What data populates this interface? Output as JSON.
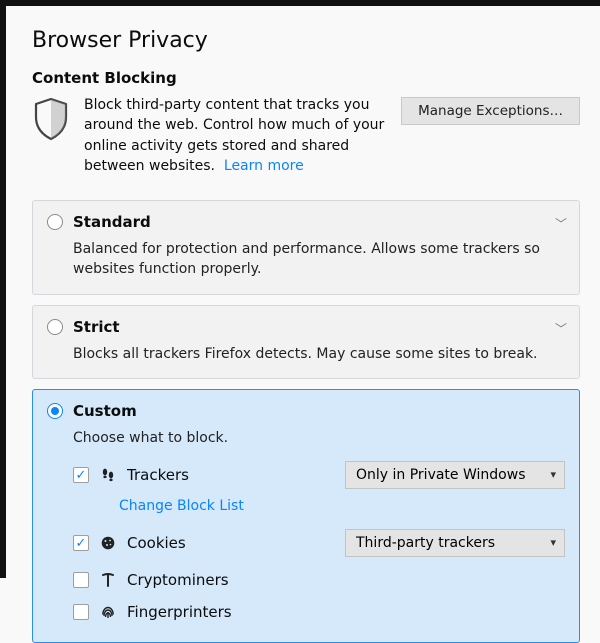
{
  "pageTitle": "Browser Privacy",
  "section": {
    "title": "Content Blocking",
    "desc": "Block third-party content that tracks you around the web. Control how much of your online activity gets stored and shared between websites.",
    "learnMore": "Learn more",
    "manageBtn": "Manage Exceptions…"
  },
  "options": {
    "standard": {
      "title": "Standard",
      "desc": "Balanced for protection and performance. Allows some trackers so websites function properly."
    },
    "strict": {
      "title": "Strict",
      "desc": "Blocks all trackers Firefox detects. May cause some sites to break."
    },
    "custom": {
      "title": "Custom",
      "desc": "Choose what to block.",
      "trackers": {
        "label": "Trackers",
        "selectValue": "Only in Private Windows",
        "changeList": "Change Block List"
      },
      "cookies": {
        "label": "Cookies",
        "selectValue": "Third-party trackers"
      },
      "cryptominers": {
        "label": "Cryptominers"
      },
      "fingerprinters": {
        "label": "Fingerprinters"
      }
    }
  }
}
